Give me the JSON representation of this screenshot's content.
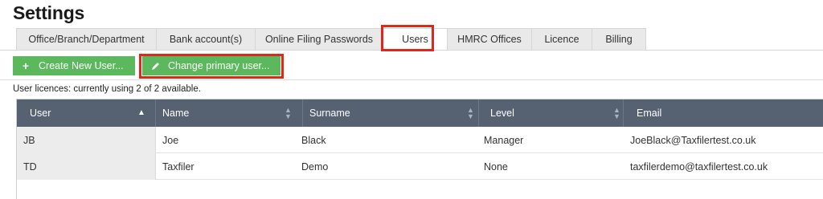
{
  "page": {
    "title": "Settings"
  },
  "tabs": [
    {
      "label": "Office/Branch/Department"
    },
    {
      "label": "Bank account(s)"
    },
    {
      "label": "Online Filing Passwords"
    },
    {
      "label": "Users",
      "active": true,
      "highlighted": true
    },
    {
      "label": "HMRC Offices"
    },
    {
      "label": "Licence"
    },
    {
      "label": "Billing"
    }
  ],
  "toolbar": {
    "create_user": {
      "label": "Create New User...",
      "icon": "plus-icon"
    },
    "change_primary": {
      "label": "Change primary user...",
      "icon": "pencil-icon",
      "highlighted": true
    }
  },
  "licence_text": "User licences: currently using 2 of 2 available.",
  "colors": {
    "button_green": "#5cb85c",
    "highlight_red": "#e3261b",
    "grid_header": "#566271"
  },
  "grid": {
    "columns": [
      {
        "label": "User",
        "sort": "ascending"
      },
      {
        "label": "Name",
        "sort": "none"
      },
      {
        "label": "Surname",
        "sort": "none"
      },
      {
        "label": "Level",
        "sort": "none"
      },
      {
        "label": "Email",
        "sort": "none"
      }
    ],
    "rows": [
      [
        "JB",
        "Joe",
        "Black",
        "Manager",
        "JoeBlack@Taxfilertest.co.uk"
      ],
      [
        "TD",
        "Taxfiler",
        "Demo",
        "None",
        "taxfilerdemo@taxfilertest.co.uk"
      ]
    ]
  }
}
